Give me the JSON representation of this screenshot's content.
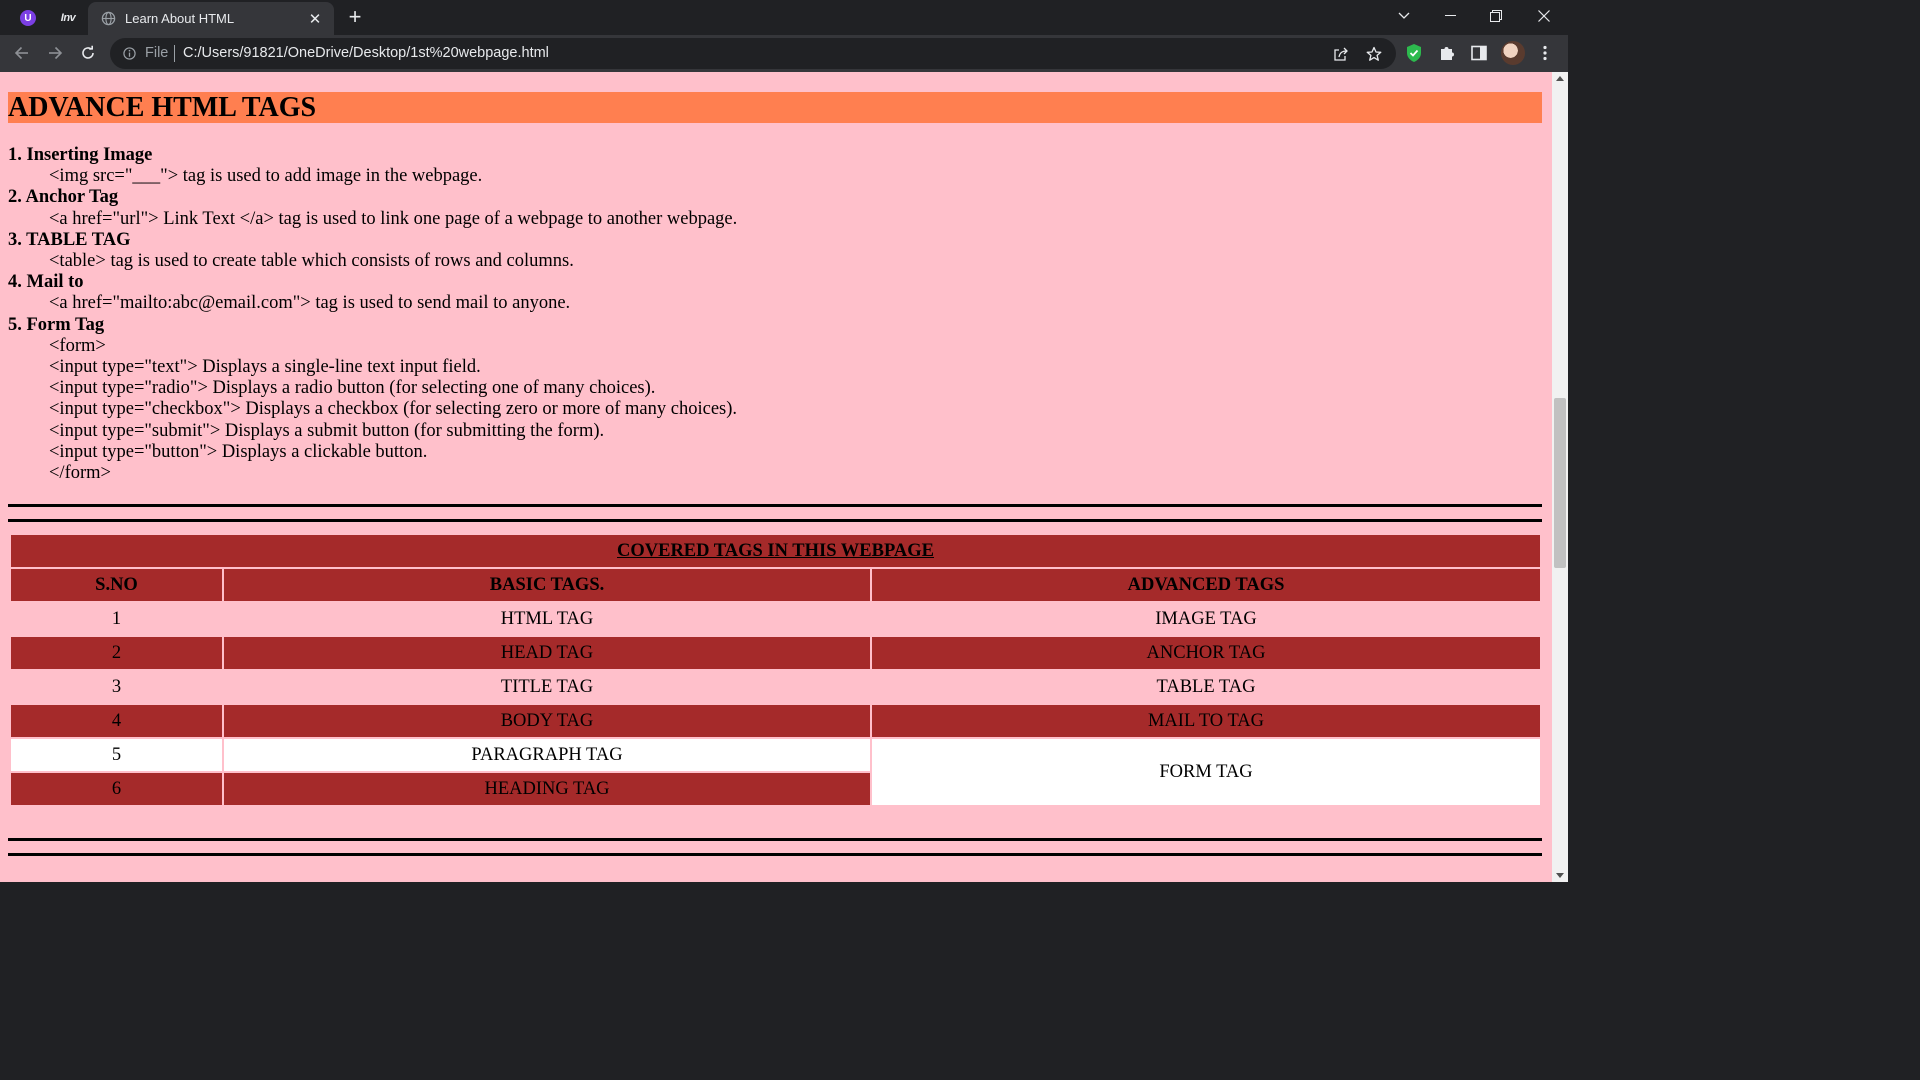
{
  "browser": {
    "pinned_tabs": [
      {
        "label": "",
        "icon": "purple-u-extension-icon"
      },
      {
        "label": "Inv",
        "icon": "inv-icon"
      }
    ],
    "active_tab": {
      "title": "Learn About HTML",
      "icon": "globe-icon"
    },
    "address": {
      "scheme": "File",
      "url": "C:/Users/91821/OneDrive/Desktop/1st%20webpage.html"
    },
    "colors": {
      "chrome_dark": "#202124",
      "toolbar": "#35363a"
    }
  },
  "page": {
    "colors": {
      "background": "#ffc0cb",
      "heading_bg": "#ff7f50",
      "table_accent": "#a52a2a",
      "table_white": "#ffffff"
    },
    "section_heading": "ADVANCE HTML TAGS",
    "items": [
      {
        "title": "1. Inserting Image",
        "lines": [
          "<img src=\"___\"> tag is used to add image in the webpage."
        ]
      },
      {
        "title": "2. Anchor Tag",
        "lines": [
          "<a href=\"url\"> Link Text </a> tag is used to link one page of a webpage to another webpage."
        ]
      },
      {
        "title": "3. TABLE TAG",
        "lines": [
          "<table> tag is used to create table which consists of rows and columns."
        ]
      },
      {
        "title": "4. Mail to",
        "lines": [
          "<a href=\"mailto:abc@email.com\"> tag is used to send mail to anyone."
        ]
      },
      {
        "title": "5. Form Tag",
        "lines": [
          "<form>",
          "<input type=\"text\"> Displays a single-line text input field.",
          "<input type=\"radio\"> Displays a radio button (for selecting one of many choices).",
          "<input type=\"checkbox\"> Displays a checkbox (for selecting zero or more of many choices).",
          "<input type=\"submit\"> Displays a submit button (for submitting the form).",
          "<input type=\"button\"> Displays a clickable button.",
          "</form>"
        ]
      }
    ],
    "table": {
      "caption": "COVERED TAGS IN THIS WEBPAGE",
      "headers": [
        "S.NO",
        "BASIC TAGS.",
        "ADVANCED TAGS"
      ],
      "rows": [
        {
          "sno": "1",
          "basic": "HTML TAG",
          "advanced": "IMAGE TAG"
        },
        {
          "sno": "2",
          "basic": "HEAD TAG",
          "advanced": "ANCHOR TAG"
        },
        {
          "sno": "3",
          "basic": "TITLE TAG",
          "advanced": "TABLE TAG"
        },
        {
          "sno": "4",
          "basic": "BODY TAG",
          "advanced": "MAIL TO TAG"
        },
        {
          "sno": "5",
          "basic": "PARAGRAPH TAG",
          "advanced": "FORM TAG"
        },
        {
          "sno": "6",
          "basic": "HEADING TAG"
        }
      ]
    }
  }
}
